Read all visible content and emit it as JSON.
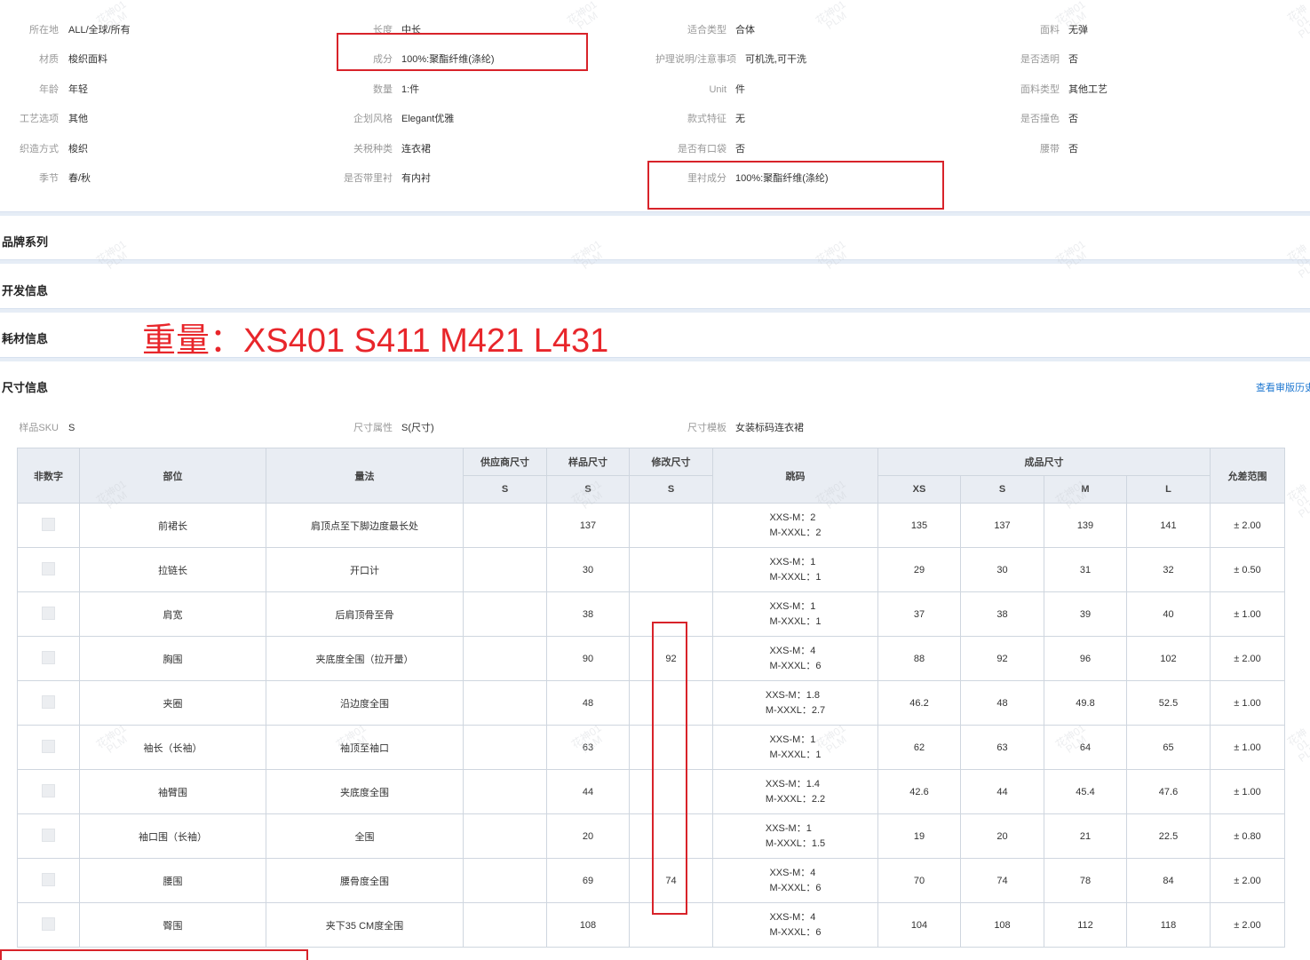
{
  "attributes": {
    "col1": [
      {
        "label": "所在地",
        "value": "ALL/全球/所有"
      },
      {
        "label": "材质",
        "value": "梭织面料"
      },
      {
        "label": "年龄",
        "value": "年轻"
      },
      {
        "label": "工艺选项",
        "value": "其他"
      },
      {
        "label": "织造方式",
        "value": "梭织"
      },
      {
        "label": "季节",
        "value": "春/秋"
      }
    ],
    "col2": [
      {
        "label": "长度",
        "value": "中长"
      },
      {
        "label": "成分",
        "value": "100%:聚酯纤维(涤纶)"
      },
      {
        "label": "数量",
        "value": "1:件"
      },
      {
        "label": "企划风格",
        "value": "Elegant优雅"
      },
      {
        "label": "关税种类",
        "value": "连衣裙"
      },
      {
        "label": "是否带里衬",
        "value": "有内衬"
      }
    ],
    "col3": [
      {
        "label": "适合类型",
        "value": "合体"
      },
      {
        "label": "护理说明/注意事项",
        "value": "可机洗,可干洗"
      },
      {
        "label": "Unit",
        "value": "件"
      },
      {
        "label": "款式特征",
        "value": "无"
      },
      {
        "label": "是否有口袋",
        "value": "否"
      },
      {
        "label": "里衬成分",
        "value": "100%:聚酯纤维(涤纶)"
      }
    ],
    "col4": [
      {
        "label": "面料",
        "value": "无弹"
      },
      {
        "label": "是否透明",
        "value": "否"
      },
      {
        "label": "面料类型",
        "value": "其他工艺"
      },
      {
        "label": "是否撞色",
        "value": "否"
      },
      {
        "label": "腰带",
        "value": "否"
      }
    ]
  },
  "sections": {
    "brand": "品牌系列",
    "dev": "开发信息",
    "materials": "耗材信息",
    "size": "尺寸信息"
  },
  "weight_note": "重量：XS401  S411  M421  L431",
  "history_link": "查看审版历史",
  "size_meta": [
    {
      "label": "样品SKU",
      "value": "S"
    },
    {
      "label": "尺寸属性",
      "value": "S(尺寸)"
    },
    {
      "label": "尺寸模板",
      "value": "女装标码连衣裙"
    }
  ],
  "table": {
    "headers": {
      "nonnumeric": "非数字",
      "part": "部位",
      "method": "量法",
      "supplier": "供应商尺寸",
      "sample": "样品尺寸",
      "modified": "修改尺寸",
      "grade": "跳码",
      "finished": "成品尺寸",
      "tolerance": "允差范围",
      "sub_supplier": "S",
      "sub_sample": "S",
      "sub_modified": "S",
      "sizes": [
        "XS",
        "S",
        "M",
        "L"
      ]
    },
    "rows": [
      {
        "part": "前裙长",
        "method": "肩顶点至下脚边度最长处",
        "supplier": "",
        "sample": "137",
        "modified": "",
        "grade1": "XXS-M：2",
        "grade2": "M-XXXL：2",
        "xs": "135",
        "s": "137",
        "m": "139",
        "l": "141",
        "tol": "± 2.00"
      },
      {
        "part": "拉链长",
        "method": "开口计",
        "supplier": "",
        "sample": "30",
        "modified": "",
        "grade1": "XXS-M：1",
        "grade2": "M-XXXL：1",
        "xs": "29",
        "s": "30",
        "m": "31",
        "l": "32",
        "tol": "± 0.50"
      },
      {
        "part": "肩宽",
        "method": "后肩顶骨至骨",
        "supplier": "",
        "sample": "38",
        "modified": "",
        "grade1": "XXS-M：1",
        "grade2": "M-XXXL：1",
        "xs": "37",
        "s": "38",
        "m": "39",
        "l": "40",
        "tol": "± 1.00"
      },
      {
        "part": "胸围",
        "method": "夹底度全围（拉开量）",
        "supplier": "",
        "sample": "90",
        "modified": "92",
        "grade1": "XXS-M：4",
        "grade2": "M-XXXL：6",
        "xs": "88",
        "s": "92",
        "m": "96",
        "l": "102",
        "tol": "± 2.00"
      },
      {
        "part": "夹圈",
        "method": "沿边度全围",
        "supplier": "",
        "sample": "48",
        "modified": "",
        "grade1": "XXS-M：1.8",
        "grade2": "M-XXXL：2.7",
        "xs": "46.2",
        "s": "48",
        "m": "49.8",
        "l": "52.5",
        "tol": "± 1.00"
      },
      {
        "part": "袖长（长袖）",
        "method": "袖顶至袖口",
        "supplier": "",
        "sample": "63",
        "modified": "",
        "grade1": "XXS-M：1",
        "grade2": "M-XXXL：1",
        "xs": "62",
        "s": "63",
        "m": "64",
        "l": "65",
        "tol": "± 1.00"
      },
      {
        "part": "袖臂围",
        "method": "夹底度全围",
        "supplier": "",
        "sample": "44",
        "modified": "",
        "grade1": "XXS-M：1.4",
        "grade2": "M-XXXL：2.2",
        "xs": "42.6",
        "s": "44",
        "m": "45.4",
        "l": "47.6",
        "tol": "± 1.00"
      },
      {
        "part": "袖口围（长袖）",
        "method": "全围",
        "supplier": "",
        "sample": "20",
        "modified": "",
        "grade1": "XXS-M：1",
        "grade2": "M-XXXL：1.5",
        "xs": "19",
        "s": "20",
        "m": "21",
        "l": "22.5",
        "tol": "± 0.80"
      },
      {
        "part": "腰围",
        "method": "腰骨度全围",
        "supplier": "",
        "sample": "69",
        "modified": "74",
        "grade1": "XXS-M：4",
        "grade2": "M-XXXL：6",
        "xs": "70",
        "s": "74",
        "m": "78",
        "l": "84",
        "tol": "± 2.00"
      },
      {
        "part": "臀围",
        "method": "夹下35 CM度全围",
        "supplier": "",
        "sample": "108",
        "modified": "",
        "grade1": "XXS-M：4",
        "grade2": "M-XXXL：6",
        "xs": "104",
        "s": "108",
        "m": "112",
        "l": "118",
        "tol": "± 2.00"
      }
    ]
  },
  "watermark": {
    "line1": "花神01",
    "line2": "PLM"
  },
  "colors": {
    "highlight_red": "#d8232a",
    "note_red": "#e8262b",
    "link_blue": "#1f78d1"
  }
}
